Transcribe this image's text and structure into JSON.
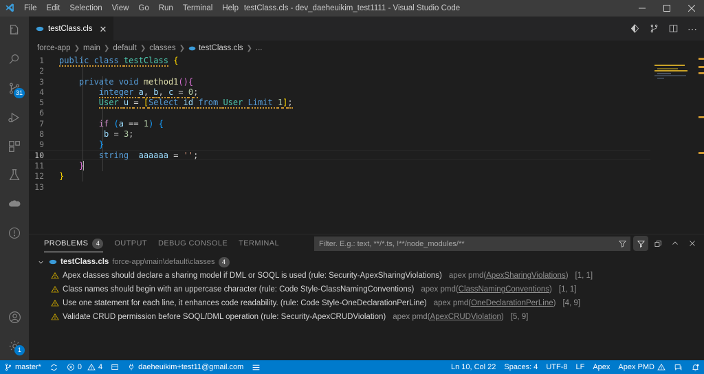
{
  "window": {
    "title": "testClass.cls - dev_daeheuikim_test1111 - Visual Studio Code",
    "minimize_label": "Minimize",
    "maximize_label": "Maximize",
    "close_label": "Close"
  },
  "menubar": {
    "items": [
      {
        "label": "File"
      },
      {
        "label": "Edit"
      },
      {
        "label": "Selection"
      },
      {
        "label": "View"
      },
      {
        "label": "Go"
      },
      {
        "label": "Run"
      },
      {
        "label": "Terminal"
      },
      {
        "label": "Help"
      }
    ]
  },
  "activitybar": {
    "items": [
      {
        "name": "explorer",
        "icon": "files-icon",
        "badge": ""
      },
      {
        "name": "search",
        "icon": "search-icon",
        "badge": ""
      },
      {
        "name": "source-control",
        "icon": "source-control-icon",
        "badge": "31"
      },
      {
        "name": "run-and-debug",
        "icon": "run-debug-icon",
        "badge": ""
      },
      {
        "name": "extensions",
        "icon": "extensions-icon",
        "badge": ""
      },
      {
        "name": "testing",
        "icon": "beaker-icon",
        "badge": ""
      },
      {
        "name": "salesforce-org",
        "icon": "cloud-icon",
        "badge": ""
      },
      {
        "name": "info",
        "icon": "info-circle-icon",
        "badge": ""
      }
    ],
    "bottom": [
      {
        "name": "accounts",
        "icon": "account-icon",
        "badge": ""
      },
      {
        "name": "settings",
        "icon": "gear-icon",
        "badge": "1"
      }
    ]
  },
  "editor": {
    "tab": {
      "label": "testClass.cls",
      "icon": "apex-class-icon",
      "close": "✕"
    },
    "tab_actions": [
      {
        "name": "sfdx-deploy-icon",
        "glyph": "diff"
      },
      {
        "name": "split-direction-icon",
        "glyph": "fork"
      },
      {
        "name": "split-editor-icon",
        "glyph": "split"
      },
      {
        "name": "more-actions-icon",
        "glyph": "⋯"
      }
    ],
    "breadcrumbs": [
      "force-app",
      "main",
      "default",
      "classes",
      "testClass.cls",
      "..."
    ],
    "lines": [
      {
        "num": "1",
        "text": "public class testClass {"
      },
      {
        "num": "2",
        "text": ""
      },
      {
        "num": "3",
        "text": "    private void method1(){"
      },
      {
        "num": "4",
        "text": "        integer a, b, c = 0;"
      },
      {
        "num": "5",
        "text": "        User u = [Select id from User Limit 1];"
      },
      {
        "num": "6",
        "text": ""
      },
      {
        "num": "7",
        "text": "        if (a == 1) {"
      },
      {
        "num": "8",
        "text": "         b = 3;"
      },
      {
        "num": "9",
        "text": "        }"
      },
      {
        "num": "10",
        "text": "        string  aaaaaa = '';"
      },
      {
        "num": "11",
        "text": "    }"
      },
      {
        "num": "12",
        "text": "}"
      },
      {
        "num": "13",
        "text": ""
      }
    ]
  },
  "panel": {
    "tabs": [
      {
        "label": "PROBLEMS",
        "count": "4",
        "active": true
      },
      {
        "label": "OUTPUT",
        "count": "",
        "active": false
      },
      {
        "label": "DEBUG CONSOLE",
        "count": "",
        "active": false
      },
      {
        "label": "TERMINAL",
        "count": "",
        "active": false
      }
    ],
    "filter": {
      "value": "",
      "placeholder": "Filter. E.g.: text, **/*.ts, !**/node_modules/**"
    },
    "actions": [
      {
        "name": "filter-problems-icon",
        "glyph": "funnel",
        "active": true
      },
      {
        "name": "collapse-all-icon",
        "glyph": "collapse"
      },
      {
        "name": "maximize-panel-icon",
        "glyph": "⌃"
      },
      {
        "name": "close-panel-icon",
        "glyph": "✕"
      }
    ],
    "group": {
      "chevron": "⌄",
      "file": "testClass.cls",
      "path": "force-app\\main\\default\\classes",
      "count": "4"
    },
    "problems": [
      {
        "severity": "warning",
        "message": "Apex classes should declare a sharing model if DML or SOQL is used (rule: Security-ApexSharingViolations)",
        "source_prefix": "apex pmd(",
        "rule": "ApexSharingViolations",
        "source_suffix": ")",
        "location": "[1, 1]"
      },
      {
        "severity": "warning",
        "message": "Class names should begin with an uppercase character (rule: Code Style-ClassNamingConventions)",
        "source_prefix": "apex pmd(",
        "rule": "ClassNamingConventions",
        "source_suffix": ")",
        "location": "[1, 1]"
      },
      {
        "severity": "warning",
        "message": "Use one statement for each line, it enhances code readability. (rule: Code Style-OneDeclarationPerLine)",
        "source_prefix": "apex pmd(",
        "rule": "OneDeclarationPerLine",
        "source_suffix": ")",
        "location": "[4, 9]"
      },
      {
        "severity": "warning",
        "message": "Validate CRUD permission before SOQL/DML operation (rule: Security-ApexCRUDViolation)",
        "source_prefix": "apex pmd(",
        "rule": "ApexCRUDViolation",
        "source_suffix": ")",
        "location": "[5, 9]"
      }
    ]
  },
  "statusbar": {
    "branch": "master*",
    "sync_icon": "sync-icon",
    "errors": "0",
    "warnings": "4",
    "port_icon": "ports-icon",
    "org": "daeheuikim+test11@gmail.com",
    "menu_icon": "list-icon",
    "cursor": "Ln 10, Col 22",
    "indent": "Spaces: 4",
    "encoding": "UTF-8",
    "eol": "LF",
    "language": "Apex",
    "pmd": "Apex PMD",
    "feedback_icon": "feedback-icon",
    "bell_icon": "bell-dot-icon",
    "accent": "#007acc"
  }
}
